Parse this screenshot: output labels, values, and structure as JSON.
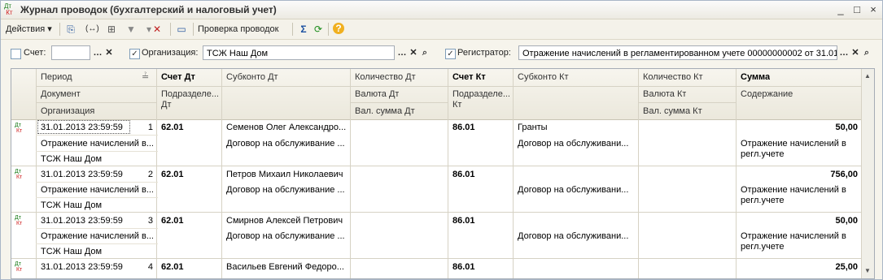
{
  "window": {
    "title": "Журнал проводок (бухгалтерский и налоговый учет)",
    "icon": "dt-kt-icon",
    "controls": [
      "_",
      "□",
      "×"
    ]
  },
  "toolbar": {
    "actions_label": "Действия",
    "check_label": "Проверка проводок",
    "sum_label": "Σ"
  },
  "filters": {
    "account_label": "Счет:",
    "account_value": "",
    "account_checked": false,
    "org_label": "Организация:",
    "org_value": "ТСЖ Наш Дом",
    "org_checked": true,
    "registrar_label": "Регистратор:",
    "registrar_value": "Отражение начислений в регламентированном учете 00000000002 от 31.01.",
    "registrar_checked": true
  },
  "columns": {
    "period": "Период",
    "document": "Документ",
    "organization": "Организация",
    "acc_dt": "Счет Дт",
    "subdiv_dt": "Подразделе...\nДт",
    "subconto_dt": "Субконто Дт",
    "qty_dt": "Количество Дт",
    "cur_dt": "Валюта Дт",
    "cur_sum_dt": "Вал. сумма Дт",
    "acc_kt": "Счет Кт",
    "subdiv_kt": "Подразделе...\nКт",
    "subconto_kt": "Субконто Кт",
    "qty_kt": "Количество Кт",
    "cur_kt": "Валюта Кт",
    "cur_sum_kt": "Вал. сумма Кт",
    "sum": "Сумма",
    "content": "Содержание"
  },
  "rows": [
    {
      "date": "31.01.2013 23:59:59",
      "num": "1",
      "acc_dt": "62.01",
      "sub_dt1": "Семенов Олег Александро...",
      "sub_dt2": "Договор на обслуживание ...",
      "acc_kt": "86.01",
      "sub_kt1": "Гранты",
      "sub_kt2": "Договор на обслуживани...",
      "sum": "50,00",
      "doc": "Отражение начислений в...",
      "org": "ТСЖ Наш Дом",
      "content1": "Отражение начислений в",
      "content2": "регл.учете"
    },
    {
      "date": "31.01.2013 23:59:59",
      "num": "2",
      "acc_dt": "62.01",
      "sub_dt1": "Петров Михаил Николаевич",
      "sub_dt2": "Договор на обслуживание ...",
      "acc_kt": "86.01",
      "sub_kt1": "",
      "sub_kt2": "Договор на обслуживани...",
      "sum": "756,00",
      "doc": "Отражение начислений в...",
      "org": "ТСЖ Наш Дом",
      "content1": "Отражение начислений в",
      "content2": "регл.учете"
    },
    {
      "date": "31.01.2013 23:59:59",
      "num": "3",
      "acc_dt": "62.01",
      "sub_dt1": "Смирнов Алексей Петрович",
      "sub_dt2": "Договор на обслуживание ...",
      "acc_kt": "86.01",
      "sub_kt1": "",
      "sub_kt2": "Договор на обслуживани...",
      "sum": "50,00",
      "doc": "Отражение начислений в...",
      "org": "ТСЖ Наш Дом",
      "content1": "Отражение начислений в",
      "content2": "регл.учете"
    },
    {
      "date": "31.01.2013 23:59:59",
      "num": "4",
      "acc_dt": "62.01",
      "sub_dt1": "Васильев Евгений Федоро...",
      "sub_dt2": "",
      "acc_kt": "86.01",
      "sub_kt1": "",
      "sub_kt2": "",
      "sum": "25,00",
      "doc": "",
      "org": "",
      "content1": "",
      "content2": ""
    }
  ]
}
